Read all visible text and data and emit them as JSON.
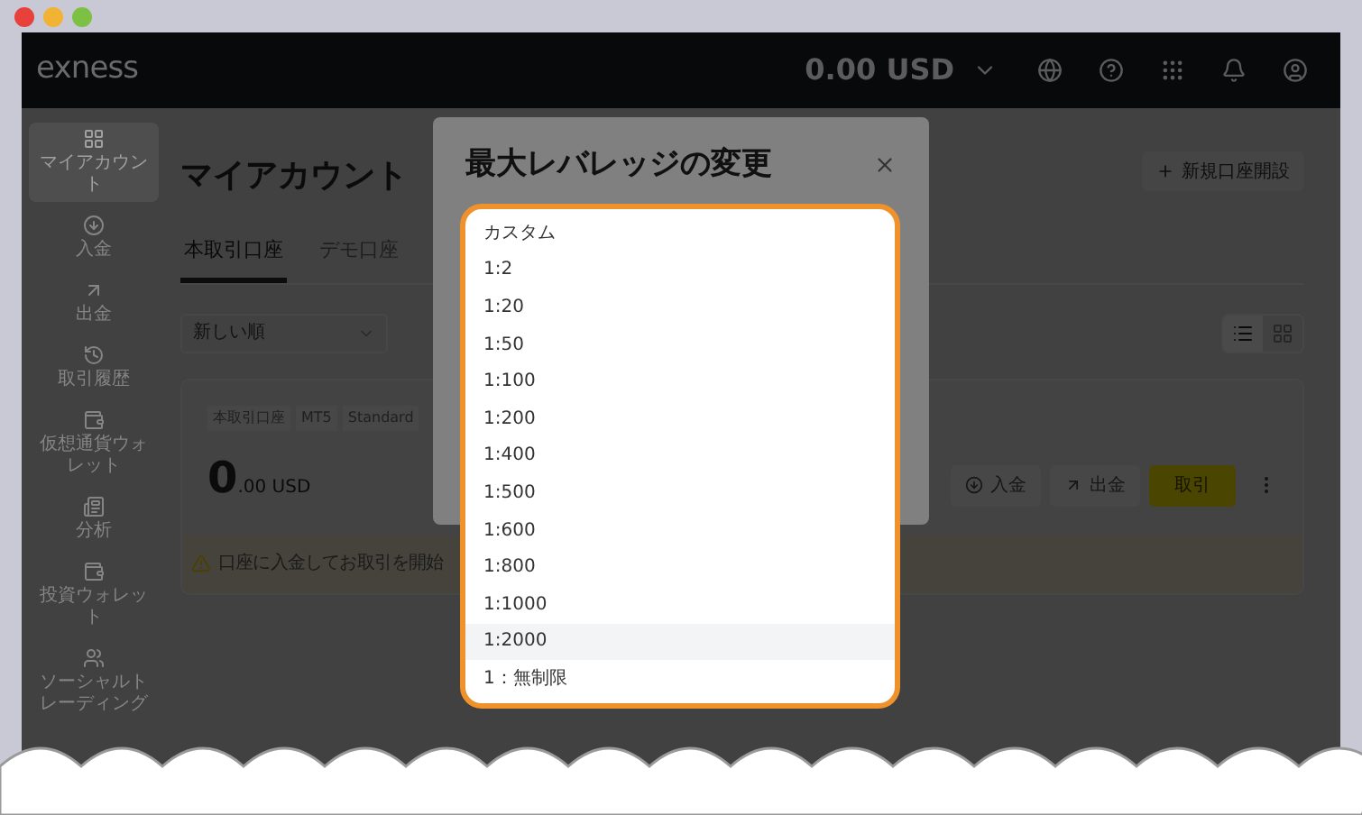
{
  "header": {
    "logo": "exness",
    "balance": "0.00 USD"
  },
  "sidebar": {
    "items": [
      {
        "label": "マイアカウント",
        "selected": true
      },
      {
        "label": "入金",
        "selected": false
      },
      {
        "label": "出金",
        "selected": false
      },
      {
        "label": "取引履歴",
        "selected": false
      },
      {
        "label": "仮想通貨ウォレット",
        "selected": false
      },
      {
        "label": "分析",
        "selected": false
      },
      {
        "label": "投資ウォレット",
        "selected": false
      },
      {
        "label": "ソーシャルトレーディング",
        "selected": false
      }
    ]
  },
  "page": {
    "title": "マイアカウント",
    "new_account_button": "新規口座開設",
    "tabs": [
      {
        "label": "本取引口座",
        "selected": true
      },
      {
        "label": "デモ口座",
        "selected": false
      }
    ],
    "sort": "新しい順",
    "views": [
      {
        "kind": "list",
        "selected": true
      },
      {
        "kind": "grid",
        "selected": false
      }
    ],
    "account": {
      "tags": [
        "本取引口座",
        "MT5",
        "Standard"
      ],
      "balance_whole": "0",
      "balance_rest": ".00 USD",
      "actions": [
        {
          "kind": "deposit",
          "label": "入金"
        },
        {
          "kind": "withdraw",
          "label": "出金"
        },
        {
          "kind": "trade",
          "label": "取引"
        }
      ],
      "warning": "口座に入金してお取引を開始"
    }
  },
  "modal": {
    "title": "最大レバレッジの変更",
    "options": [
      {
        "label": "カスタム",
        "selected": false
      },
      {
        "label": "1:2",
        "selected": false
      },
      {
        "label": "1:20",
        "selected": false
      },
      {
        "label": "1:50",
        "selected": false
      },
      {
        "label": "1:100",
        "selected": false
      },
      {
        "label": "1:200",
        "selected": false
      },
      {
        "label": "1:400",
        "selected": false
      },
      {
        "label": "1:500",
        "selected": false
      },
      {
        "label": "1:600",
        "selected": false
      },
      {
        "label": "1:800",
        "selected": false
      },
      {
        "label": "1:1000",
        "selected": false
      },
      {
        "label": "1:2000",
        "selected": true
      },
      {
        "label": "1：無制限",
        "selected": false
      }
    ]
  }
}
